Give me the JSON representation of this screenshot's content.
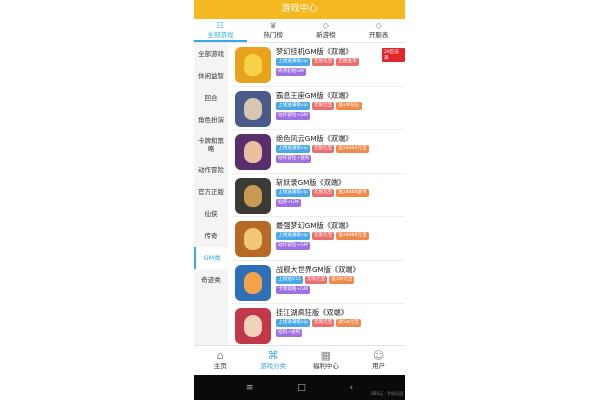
{
  "header": {
    "title": "游戏中心"
  },
  "tabs": [
    {
      "label": "全部游戏",
      "icon": "grid-icon",
      "glyph": "☷",
      "active": true
    },
    {
      "label": "热门榜",
      "icon": "crown-icon",
      "glyph": "♛",
      "active": false
    },
    {
      "label": "新游榜",
      "icon": "diamond-icon",
      "glyph": "◇",
      "active": false
    },
    {
      "label": "开服表",
      "icon": "diamond-icon",
      "glyph": "◇",
      "active": false
    }
  ],
  "sidebar": {
    "items": [
      {
        "label": "全部游戏"
      },
      {
        "label": "休闲益智"
      },
      {
        "label": "回合"
      },
      {
        "label": "角色扮演"
      },
      {
        "label": "卡牌和策略"
      },
      {
        "label": "动作冒险"
      },
      {
        "label": "官方正版"
      },
      {
        "label": "仙侠"
      },
      {
        "label": "传奇"
      },
      {
        "label": "GM类",
        "active": true
      },
      {
        "label": "奇迹类"
      }
    ]
  },
  "games": [
    {
      "title": "梦幻挂机GM版《双端》",
      "badge": "29区前来",
      "thumb": "#e9a21b",
      "face": "#f6d24a",
      "tags1": [
        [
          "上线送满级vip",
          "blue"
        ],
        [
          "无限元宝",
          "red"
        ],
        [
          "无限金币",
          "red"
        ]
      ],
      "tags2": [
        [
          "终须初始GM",
          "purple"
        ]
      ]
    },
    {
      "title": "霸息王座GM版《双端》",
      "badge": "",
      "thumb": "#4a5a8a",
      "face": "#d9c7b2",
      "tags1": [
        [
          "上线送满级vip",
          "blue"
        ],
        [
          "无限元宝",
          "red"
        ],
        [
          "送2W钻石",
          "orange"
        ]
      ],
      "tags2": [
        [
          "动作冒险+GM",
          "purple"
        ]
      ]
    },
    {
      "title": "绝色风云GM版《双端》",
      "badge": "",
      "thumb": "#5a2d6e",
      "face": "#e8c0a0",
      "tags1": [
        [
          "上线送满级vip",
          "blue"
        ],
        [
          "无限元宝",
          "red"
        ],
        [
          "送28888元宝",
          "orange"
        ]
      ],
      "tags2": [
        [
          "动作冒险+送利",
          "purple"
        ]
      ]
    },
    {
      "title": "斩妖录GM版《双端》",
      "badge": "",
      "thumb": "#3c3a35",
      "face": "#c69a52",
      "tags1": [
        [
          "上线送满级vip",
          "blue"
        ],
        [
          "无限元宝",
          "red"
        ],
        [
          "送28888金币",
          "orange"
        ]
      ],
      "tags2": [
        [
          "仙侠+GM",
          "purple"
        ]
      ]
    },
    {
      "title": "最强梦幻GM版《双端》",
      "badge": "",
      "thumb": "#b76a25",
      "face": "#f0c878",
      "tags1": [
        [
          "上线送满级vip",
          "blue"
        ],
        [
          "无限元宝",
          "red"
        ],
        [
          "送28888元宝",
          "orange"
        ]
      ],
      "tags2": [
        [
          "动作冒险+GM",
          "purple"
        ]
      ]
    },
    {
      "title": "战舰大世界GM版《双端》",
      "badge": "",
      "thumb": "#2f6fb8",
      "face": "#f2a24a",
      "tags1": [
        [
          "上线送V15",
          "blue"
        ],
        [
          "无限元宝",
          "red"
        ],
        [
          "送3W元宝",
          "orange"
        ]
      ],
      "tags2": [
        [
          "卡牌策略+GM",
          "purple"
        ]
      ]
    },
    {
      "title": "挂江湖疯狂版《双端》",
      "badge": "",
      "thumb": "#c0384a",
      "face": "#f2d2b8",
      "tags1": [
        [
          "上线送满级vip",
          "blue"
        ],
        [
          "无限元宝",
          "red"
        ],
        [
          "送5w元宝",
          "orange"
        ]
      ],
      "tags2": [
        [
          "挂机+送利",
          "purple"
        ]
      ]
    }
  ],
  "bottom_nav": [
    {
      "label": "主页",
      "icon": "home-icon",
      "glyph": "⌂",
      "active": false
    },
    {
      "label": "游戏分类",
      "icon": "command-icon",
      "glyph": "⌘",
      "active": true
    },
    {
      "label": "福利中心",
      "icon": "grid-icon",
      "glyph": "▦",
      "active": false
    },
    {
      "label": "用户",
      "icon": "user-icon",
      "glyph": "☺",
      "active": false
    }
  ],
  "system_bar": {
    "buttons": [
      "≡",
      "□",
      "‹"
    ]
  },
  "watermark": "BB5元 · 手机乐园"
}
